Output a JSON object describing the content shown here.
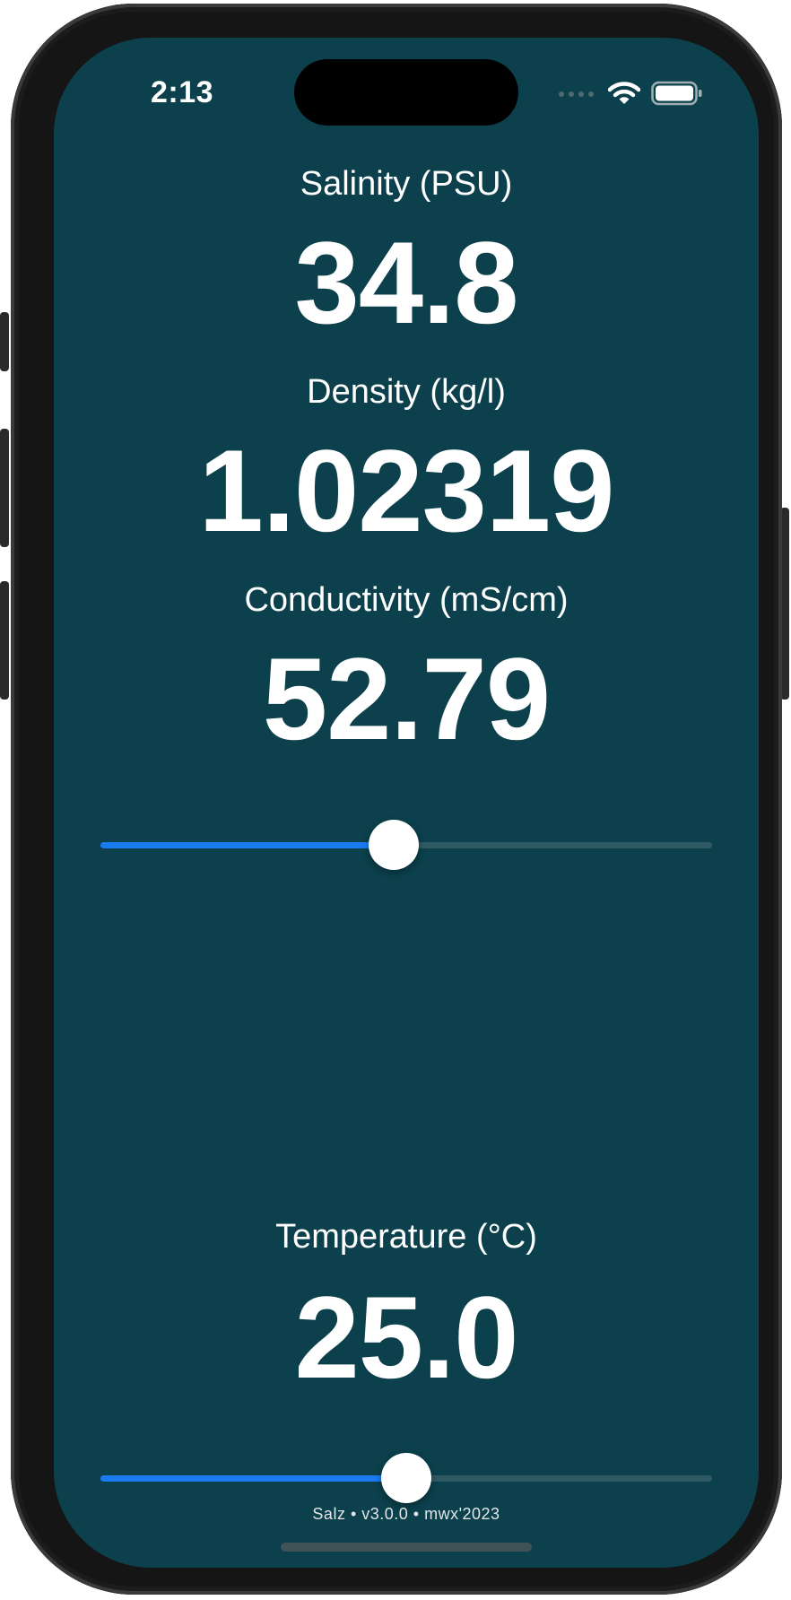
{
  "status_bar": {
    "time": "2:13",
    "icons": [
      "signal-dots-icon",
      "wifi-icon",
      "battery-icon"
    ]
  },
  "readings": {
    "salinity": {
      "label": "Salinity (PSU)",
      "value": "34.8"
    },
    "density": {
      "label": "Density (kg/l)",
      "value": "1.02319"
    },
    "conductivity": {
      "label": "Conductivity (mS/cm)",
      "value": "52.79"
    },
    "temperature": {
      "label": "Temperature (°C)",
      "value": "25.0"
    }
  },
  "sliders": {
    "salinity": {
      "level": 0.48
    },
    "temperature": {
      "level": 0.5
    }
  },
  "footer": {
    "text": "Salz • v3.0.0 • mwx'2023"
  },
  "colors": {
    "background": "#0b404c",
    "accent": "#1a7af0",
    "text": "#ffffff"
  }
}
